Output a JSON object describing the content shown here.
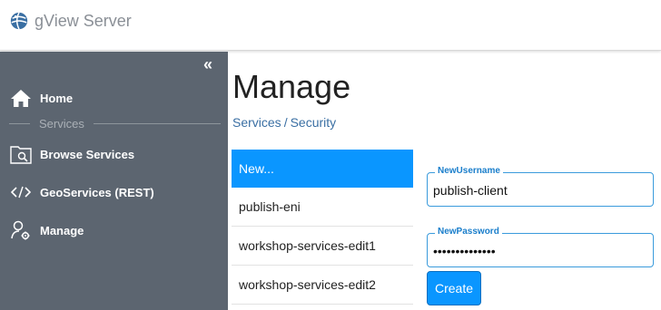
{
  "app": {
    "title": "gView Server",
    "logo_icon": "globe-icon"
  },
  "sidebar": {
    "collapse_label": "«",
    "items": [
      {
        "label": "Home",
        "icon": "home-icon"
      },
      {
        "label": "Browse Services",
        "icon": "browse-folder-icon"
      },
      {
        "label": "GeoServices (REST)",
        "icon": "code-icon"
      },
      {
        "label": "Manage",
        "icon": "user-gear-icon"
      }
    ],
    "section_label": "Services"
  },
  "main": {
    "title": "Manage",
    "breadcrumb": {
      "first": "Services",
      "separator": "/",
      "second": "Security"
    }
  },
  "users_list": {
    "items": [
      "New...",
      "publish-eni",
      "workshop-services-edit1",
      "workshop-services-edit2"
    ],
    "active_index": 0
  },
  "form": {
    "username_label": "NewUsername",
    "username_value": "publish-client",
    "password_label": "NewPassword",
    "password_value": "••••••••••••••",
    "create_label": "Create"
  },
  "colors": {
    "sidebar_bg": "#5c6570",
    "accent": "#0a96ff",
    "link": "#3a6fa3"
  }
}
